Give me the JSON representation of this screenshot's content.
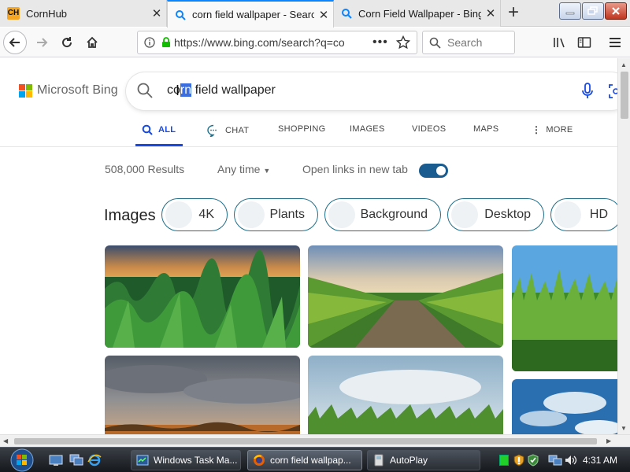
{
  "browser": {
    "tabs": [
      {
        "title": "CornHub",
        "favicon": "CH",
        "active": false
      },
      {
        "title": "corn field wallpaper - Search",
        "favicon": "search-icon",
        "active": true
      },
      {
        "title": "Corn Field Wallpaper - Bing I",
        "favicon": "search-icon",
        "active": false
      }
    ],
    "url": "https://www.bing.com/search?q=co",
    "search_placeholder": "Search"
  },
  "bing": {
    "logo_text": "Microsoft Bing",
    "query_before": "co",
    "query_selected": "rn",
    "query_after": " field wallpaper",
    "scopes": [
      "ALL",
      "CHAT",
      "SHOPPING",
      "IMAGES",
      "VIDEOS",
      "MAPS",
      "MORE"
    ],
    "active_scope": "ALL",
    "results_count": "508,000 Results",
    "time_filter": "Any time",
    "open_links_label": "Open links in new tab",
    "open_links_enabled": true,
    "images_label": "Images",
    "image_chips": [
      "4K",
      "Plants",
      "Background",
      "Desktop",
      "HD"
    ]
  },
  "taskbar": {
    "items": [
      {
        "label": "Windows Task Ma...",
        "active": false
      },
      {
        "label": "corn field wallpap...",
        "active": true
      },
      {
        "label": "AutoPlay",
        "active": false
      }
    ],
    "clock": "4:31 AM"
  },
  "colors": {
    "bing_accent": "#174ae4",
    "toggle_on": "#1a5c8f",
    "chip_border": "#1f6f8b",
    "tab_highlight": "#0a84ff"
  }
}
